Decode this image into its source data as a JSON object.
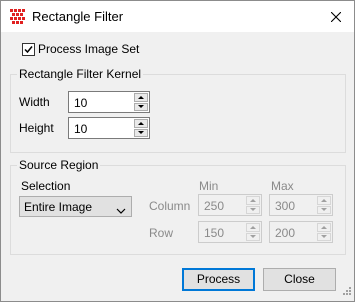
{
  "window": {
    "title": "Rectangle Filter",
    "app_icon": "grid-icon",
    "close_icon": "close-icon"
  },
  "process_image_set": {
    "label": "Process Image Set",
    "checked": true
  },
  "kernel": {
    "title": "Rectangle Filter Kernel",
    "width": {
      "label": "Width",
      "value": "10"
    },
    "height": {
      "label": "Height",
      "value": "10"
    }
  },
  "source_region": {
    "title": "Source Region",
    "selection_label": "Selection",
    "selection_value": "Entire Image",
    "min_header": "Min",
    "max_header": "Max",
    "column": {
      "label": "Column",
      "min": "250",
      "max": "300"
    },
    "row": {
      "label": "Row",
      "min": "150",
      "max": "200"
    }
  },
  "buttons": {
    "process": "Process",
    "close": "Close"
  },
  "colors": {
    "accent": "#0078d7",
    "icon_red": "#e02020"
  }
}
